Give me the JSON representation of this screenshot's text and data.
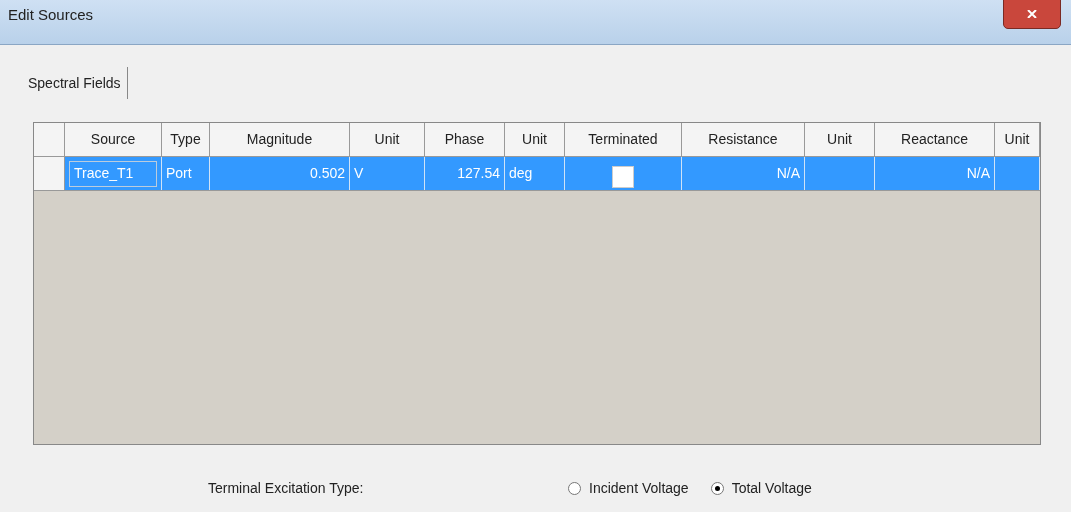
{
  "window": {
    "title": "Edit Sources"
  },
  "tabs": [
    {
      "label": "Spectral Fields",
      "selected": true
    }
  ],
  "table": {
    "columns": [
      {
        "label": "Source"
      },
      {
        "label": "Type"
      },
      {
        "label": "Magnitude"
      },
      {
        "label": "Unit"
      },
      {
        "label": "Phase"
      },
      {
        "label": "Unit"
      },
      {
        "label": "Terminated"
      },
      {
        "label": "Resistance"
      },
      {
        "label": "Unit"
      },
      {
        "label": "Reactance"
      },
      {
        "label": "Unit"
      }
    ],
    "rows": [
      {
        "selected": true,
        "cells": [
          {
            "kind": "edit",
            "text": "Trace_T1"
          },
          {
            "kind": "text",
            "text": "Port"
          },
          {
            "kind": "num",
            "text": "0.502"
          },
          {
            "kind": "text",
            "text": "V"
          },
          {
            "kind": "num",
            "text": "127.54"
          },
          {
            "kind": "text",
            "text": "deg"
          },
          {
            "kind": "check",
            "checked": false
          },
          {
            "kind": "num",
            "text": "N/A"
          },
          {
            "kind": "empty"
          },
          {
            "kind": "num",
            "text": "N/A"
          },
          {
            "kind": "empty"
          }
        ]
      }
    ]
  },
  "excitation": {
    "label": "Terminal Excitation Type:",
    "options": [
      {
        "label": "Incident Voltage",
        "selected": false
      },
      {
        "label": "Total Voltage",
        "selected": true
      }
    ]
  }
}
